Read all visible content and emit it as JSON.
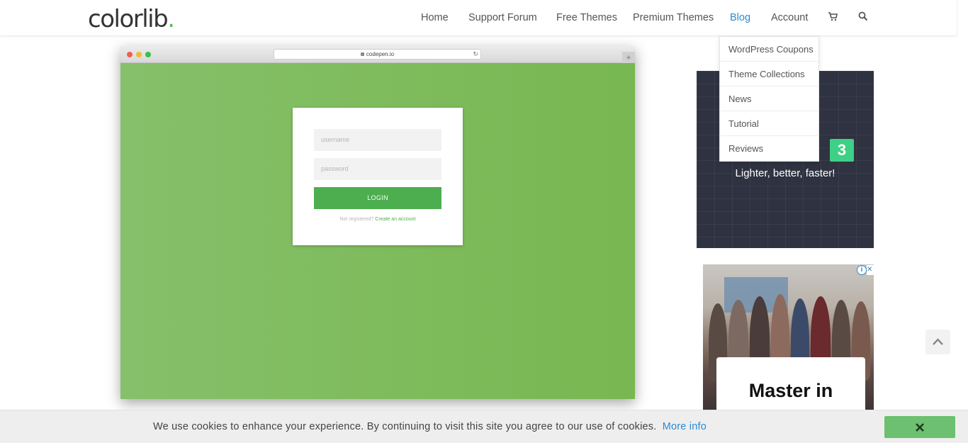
{
  "header": {
    "logo_text": "colorlib",
    "logo_dot": ".",
    "nav": [
      {
        "label": "Home",
        "active": false
      },
      {
        "label": "Support Forum",
        "active": false
      },
      {
        "label": "Free Themes",
        "active": false
      },
      {
        "label": "Premium Themes",
        "active": false
      },
      {
        "label": "Blog",
        "active": true
      },
      {
        "label": "Account",
        "active": false
      }
    ],
    "icons": [
      "cart-icon",
      "search-icon"
    ]
  },
  "dropdown": {
    "items": [
      "WordPress Coupons",
      "Theme Collections",
      "News",
      "Tutorial",
      "Reviews"
    ]
  },
  "mockup": {
    "url": "codepen.io",
    "username_placeholder": "username",
    "password_placeholder": "password",
    "login_label": "LOGIN",
    "not_registered": "Not registered?",
    "create_account": "Create an account"
  },
  "ad1": {
    "badge": "3",
    "tagline": "Lighter, better, faster!"
  },
  "ad2": {
    "headline": "Master in"
  },
  "cookie": {
    "message": "We use cookies to enhance your experience. By continuing to visit this site you agree to our use of cookies.",
    "more_info": "More info"
  },
  "colors": {
    "accent": "#5cb85c",
    "link": "#2a8bd1",
    "mock_green": "#7ab957",
    "button_green": "#4cae4f"
  }
}
